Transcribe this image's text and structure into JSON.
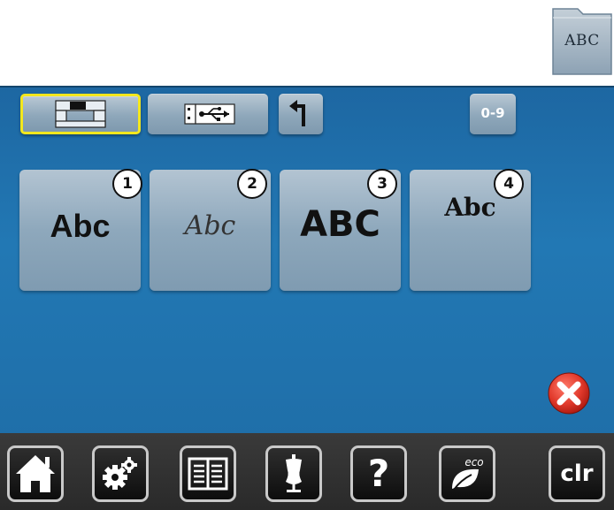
{
  "folder": {
    "label": "ABC",
    "icon": "folder-icon"
  },
  "toolbar": {
    "items": [
      {
        "name": "machine-view",
        "icon": "sewing-machine-icon",
        "selected": true
      },
      {
        "name": "usb",
        "icon": "usb-icon",
        "selected": false
      },
      {
        "name": "back",
        "icon": "return-arrow-icon",
        "selected": false
      },
      {
        "name": "numbers",
        "label": "0-9",
        "selected": false
      }
    ]
  },
  "fonts": [
    {
      "number": "1",
      "sample": "Abc"
    },
    {
      "number": "2",
      "sample": "Abc"
    },
    {
      "number": "3",
      "sample": "ABC"
    },
    {
      "number": "4",
      "sample": "Abc"
    }
  ],
  "close": {
    "icon": "close-icon",
    "color": "#d9342b"
  },
  "bottombar": {
    "items": [
      {
        "name": "home",
        "icon": "home-icon"
      },
      {
        "name": "setup",
        "icon": "gears-icon"
      },
      {
        "name": "tutorial",
        "icon": "book-icon"
      },
      {
        "name": "creative-consultant",
        "icon": "dress-form-icon"
      },
      {
        "name": "help",
        "label": "?"
      },
      {
        "name": "eco",
        "label": "eco",
        "icon": "leaf-icon"
      },
      {
        "name": "clear",
        "label": "clr"
      }
    ]
  },
  "colors": {
    "screen": "#2175b2",
    "button": "#9bb1c3",
    "selected_border": "#f3e71d",
    "bottom_bar": "#2f2f2f"
  }
}
